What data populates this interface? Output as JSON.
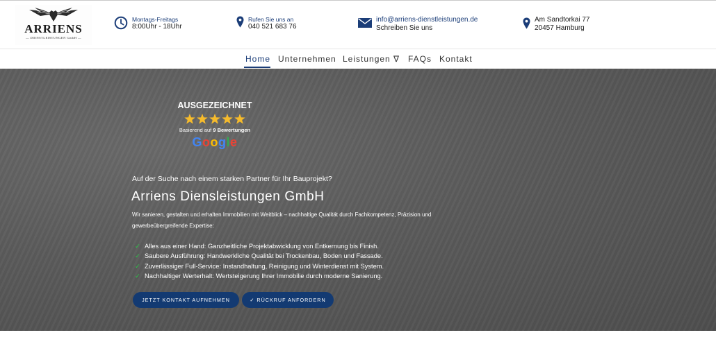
{
  "logo": {
    "name": "ARRIENS",
    "subtitle": "DIENSTLEISTUNGEN GmbH"
  },
  "topbar": {
    "hours": {
      "line1": "Montags-Freitags",
      "line2": "8:00Uhr - 18Uhr"
    },
    "phone": {
      "line1": "Rufen Sie uns an",
      "line2": "040 521 683 76"
    },
    "email": {
      "line1": "info@arriens-dienstleistungen.de",
      "line2": "Schreiben Sie uns"
    },
    "address": {
      "line1": "Am Sandtorkai 77",
      "line2": "20457 Hamburg"
    }
  },
  "nav": {
    "items": [
      {
        "label": "Home"
      },
      {
        "label": "Unternehmen"
      },
      {
        "label": "Leistungen ∇"
      },
      {
        "label": "FAQs"
      },
      {
        "label": "Kontakt"
      }
    ],
    "active": "Home"
  },
  "award": {
    "title": "AUSGEZEICHNET",
    "rating": 5,
    "rating_max": 5,
    "basis_prefix": "Basierend auf",
    "basis_count": "9 Bewertungen",
    "provider": "Google"
  },
  "hero": {
    "tagline": "Auf der Suche nach einem starken Partner für Ihr Bauprojekt?",
    "headline": "Arriens Diensleistungen GmbH",
    "description": "Wir sanieren, gestalten und erhalten Immobilien mit Weitblick – nachhaltige Qualität durch Fachkompetenz, Präzision und gewerbeübergreifende Expertise:",
    "bullets": [
      "Alles aus einer Hand: Ganzheitliche Projektabwicklung von Entkernung bis Finish.",
      "Saubere Ausführung: Handwerkliche Qualität bei Trockenbau, Boden und Fassade.",
      "Zuverlässiger Full-Service: Instandhaltung, Reinigung und Winterdienst mit System.",
      "Nachhaltiger Werterhalt: Wertsteigerung Ihrer Immobilie durch moderne Sanierung."
    ],
    "check_icon": "✓",
    "cta_primary": "JETZT KONTAKT AUFNEHMEN",
    "cta_secondary": "✓ RÜCKRUF ANFORDERN"
  },
  "colors": {
    "brand_blue": "#133a72",
    "accent_blue": "#1b3d78",
    "check_green": "#2fc24a",
    "star_gold": "#f6bb2c"
  },
  "icons": [
    "clock-icon",
    "location-pin-icon",
    "envelope-icon",
    "star-icon",
    "check-icon",
    "eagle-logo-icon"
  ]
}
